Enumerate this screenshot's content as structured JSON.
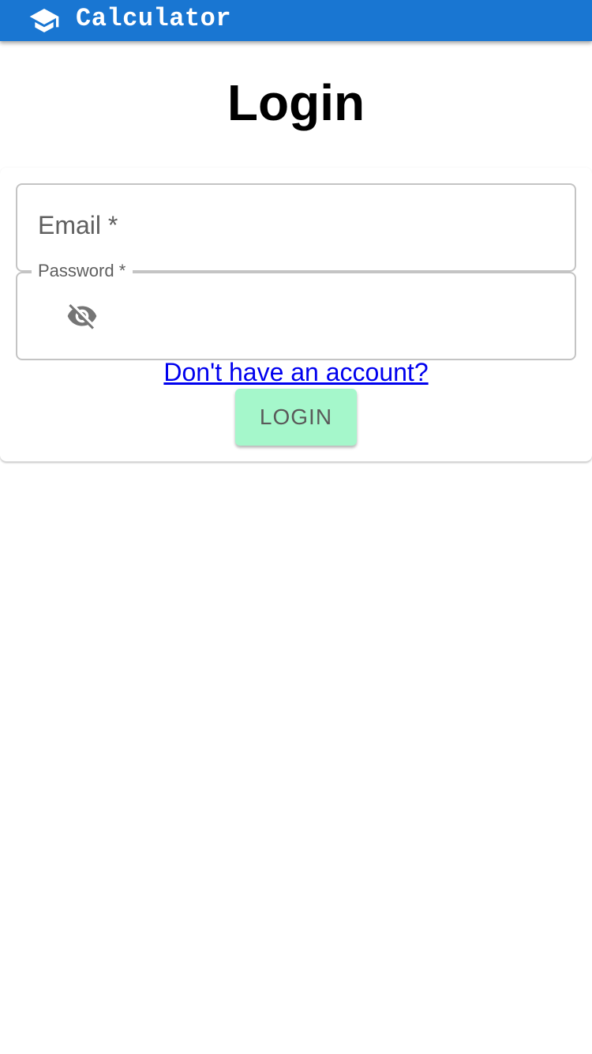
{
  "app_bar": {
    "title": "Calculator",
    "icon": "graduation-cap-icon",
    "color": "#1976d2"
  },
  "page": {
    "title": "Login"
  },
  "form": {
    "email": {
      "label": "Email *",
      "value": ""
    },
    "password": {
      "label": "Password *",
      "value": "",
      "visibility_icon": "visibility-off-icon"
    },
    "signup_link": "Don't have an account?",
    "login_button": "LOGIN",
    "login_button_color": "#a5f7cb"
  }
}
